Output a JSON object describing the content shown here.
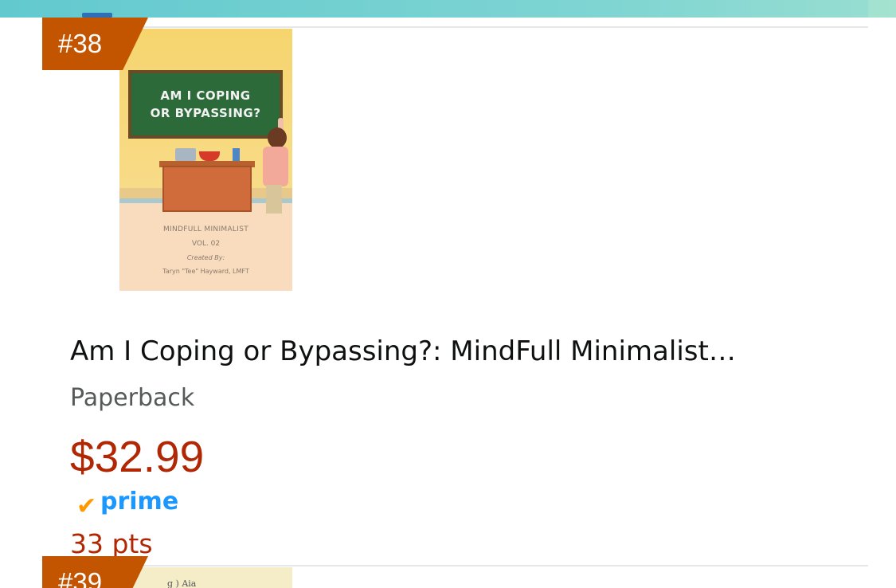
{
  "items": [
    {
      "rank": "#38",
      "cover": {
        "board_line1": "AM I COPING",
        "board_line2": "OR BYPASSING?",
        "series": "MINDFULL MINIMALIST",
        "volume": "VOL. 02",
        "created_by": "Created By:",
        "author": "Taryn \"Tee\" Hayward, LMFT"
      },
      "title": "Am I Coping or Bypassing?: MindFull Minimalist…",
      "format": "Paperback",
      "price": "$32.99",
      "prime_label": "prime",
      "prime_check_icon": "prime-check-icon",
      "points": "33 pts"
    },
    {
      "rank": "#39",
      "cover": {
        "partial_text": "g ) Aia"
      }
    }
  ],
  "colors": {
    "rank_badge": "#c45500",
    "price": "#b12704",
    "prime_blue": "#1a98ff",
    "prime_check": "#ff9900",
    "title": "#0f1111",
    "format": "#565959"
  }
}
